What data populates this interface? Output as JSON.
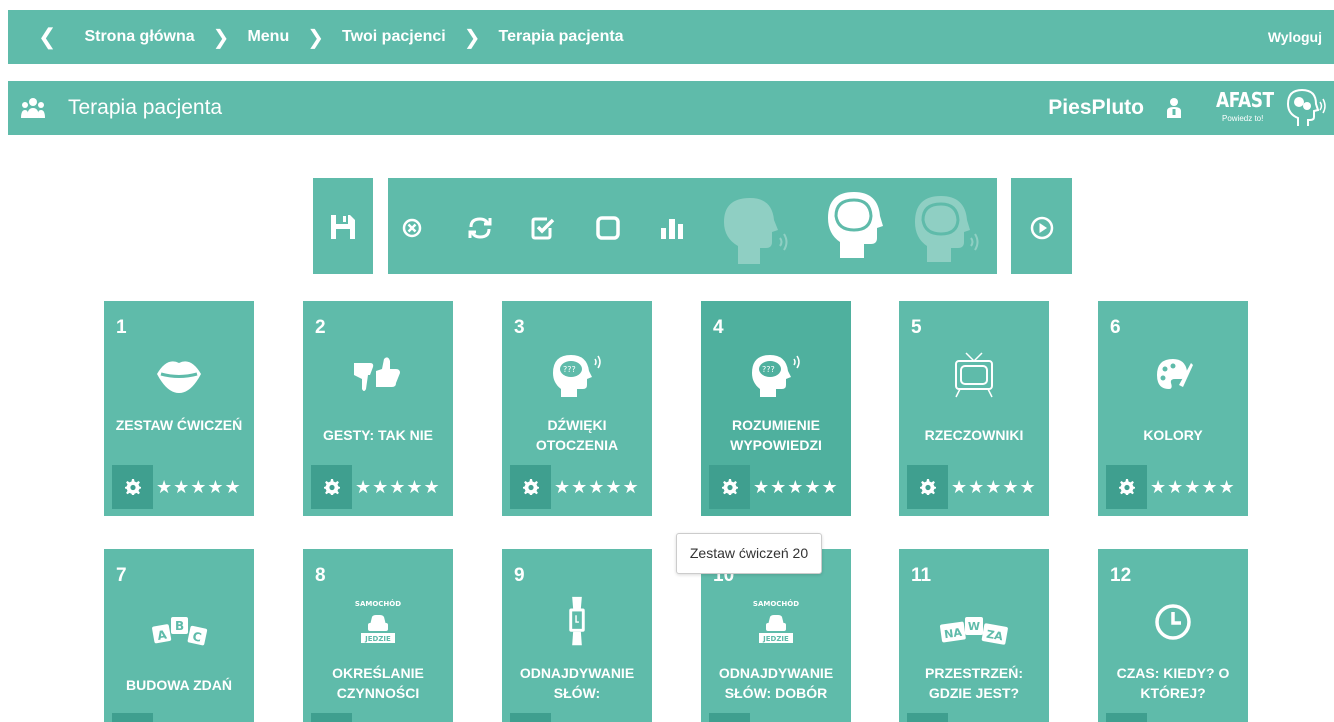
{
  "breadcrumb": {
    "items": [
      "Strona główna",
      "Menu",
      "Twoi pacjenci",
      "Terapia pacjenta"
    ],
    "logout": "Wyloguj"
  },
  "header": {
    "title": "Terapia pacjenta",
    "username": "PiesPluto",
    "logo": {
      "name": "AFAST",
      "tagline": "Powiedz to!"
    }
  },
  "toolbar": {
    "buttons": [
      "save-icon",
      "cancel-icon",
      "refresh-icon",
      "check-icon",
      "square-icon",
      "stats-icon",
      "speaking-head-icon",
      "thinking-head-icon",
      "listening-head-icon",
      "play-icon"
    ]
  },
  "tiles": [
    {
      "num": "1",
      "label": "ZESTAW ĆWICZEŃ",
      "icon": "lips-icon",
      "stars": "★★★★★"
    },
    {
      "num": "2",
      "label": "GESTY: TAK NIE",
      "icon": "thumbs-icon",
      "stars": "★★★★★"
    },
    {
      "num": "3",
      "label": "DŹWIĘKI OTOCZENIA",
      "icon": "head-sound-icon",
      "stars": "★★★★★"
    },
    {
      "num": "4",
      "label": "ROZUMIENIE WYPOWIEDZI",
      "icon": "head-sound-icon",
      "stars": "★★★★★"
    },
    {
      "num": "5",
      "label": "RZECZOWNIKI",
      "icon": "tv-icon",
      "stars": "★★★★★"
    },
    {
      "num": "6",
      "label": "KOLORY",
      "icon": "palette-icon",
      "stars": "★★★★★"
    },
    {
      "num": "7",
      "label": "BUDOWA ZDAŃ",
      "icon": "abc-blocks-icon"
    },
    {
      "num": "8",
      "label": "OKREŚLANIE CZYNNOŚCI",
      "icon": "car-card-icon",
      "card_top": "SAMOCHÓD",
      "card_bottom": "JEDZIE"
    },
    {
      "num": "9",
      "label": "ODNAJDYWANIE SŁÓW:",
      "icon": "watch-icon"
    },
    {
      "num": "10",
      "label": "ODNAJDYWANIE SŁÓW: DOBÓR",
      "icon": "car-card-icon",
      "card_top": "SAMOCHÓD",
      "card_bottom": "JEDZIE"
    },
    {
      "num": "11",
      "label": "PRZESTRZEŃ: GDZIE JEST?",
      "icon": "naza-blocks-icon",
      "blocks": [
        "NA",
        "W",
        "ZA"
      ]
    },
    {
      "num": "12",
      "label": "CZAS: KIEDY? O KTÓREJ?",
      "icon": "clock-icon"
    }
  ],
  "tooltip": "Zestaw ćwiczeń 20",
  "blocks_abc": [
    "A",
    "B",
    "C"
  ],
  "colors": {
    "accent": "#5fbbaa",
    "accent_dark": "#3f9f8f",
    "tile_active": "#4fb09e"
  }
}
